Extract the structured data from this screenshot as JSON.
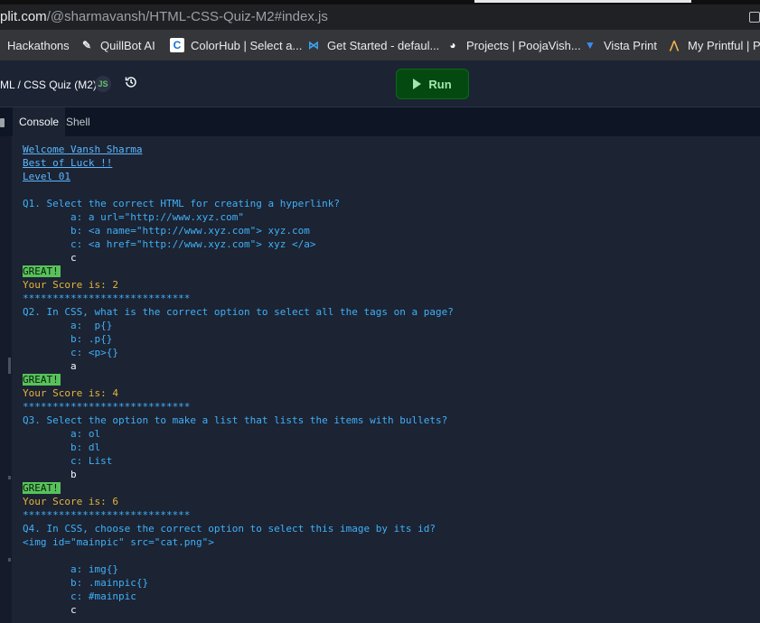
{
  "browser": {
    "url_host": "plit.com",
    "url_path": "/@sharmavansh/HTML-CSS-Quiz-M2#index.js",
    "bookmarks": [
      {
        "label": "Hackathons",
        "icon": "none"
      },
      {
        "label": "QuillBot AI",
        "icon": "quillbot-icon"
      },
      {
        "label": "ColorHub | Select a...",
        "icon": "colorhub-icon"
      },
      {
        "label": "Get Started - defaul...",
        "icon": "vscode-icon"
      },
      {
        "label": "Projects | PoojaVish...",
        "icon": "projects-icon"
      },
      {
        "label": "Vista Print",
        "icon": "vistaprint-icon"
      },
      {
        "label": "My Printful | Pr",
        "icon": "printful-icon"
      }
    ]
  },
  "repl": {
    "title": "ML / CSS Quiz (M2)",
    "run_label": "Run"
  },
  "tabs": [
    {
      "label": "Console",
      "active": true
    },
    {
      "label": "Shell",
      "active": false
    }
  ],
  "console": {
    "lines": [
      {
        "kind": "under",
        "text": "Welcome Vansh Sharma"
      },
      {
        "kind": "under",
        "text": "Best of Luck !!"
      },
      {
        "kind": "under",
        "text": "Level 01"
      },
      {
        "kind": "blank",
        "text": ""
      },
      {
        "kind": "q",
        "text": "Q1. Select the correct HTML for creating a hyperlink?"
      },
      {
        "kind": "q",
        "text": "        a: a url=\"http://www.xyz.com\""
      },
      {
        "kind": "q",
        "text": "        b: <a name=\"http://www.xyz.com\"> xyz.com"
      },
      {
        "kind": "q",
        "text": "        c: <a href=\"http://www.xyz.com\"> xyz </a>"
      },
      {
        "kind": "answer",
        "text": "        c"
      },
      {
        "kind": "great",
        "text": "GREAT!"
      },
      {
        "kind": "score",
        "text": "Your Score is: 2"
      },
      {
        "kind": "q",
        "text": "****************************"
      },
      {
        "kind": "q",
        "text": "Q2. In CSS, what is the correct option to select all the tags on a page?"
      },
      {
        "kind": "q",
        "text": "        a:  p{}"
      },
      {
        "kind": "q",
        "text": "        b: .p{}"
      },
      {
        "kind": "q",
        "text": "        c: <p>{}"
      },
      {
        "kind": "answer",
        "text": "        a"
      },
      {
        "kind": "great",
        "text": "GREAT!"
      },
      {
        "kind": "score",
        "text": "Your Score is: 4"
      },
      {
        "kind": "q",
        "text": "****************************"
      },
      {
        "kind": "q",
        "text": "Q3. Select the option to make a list that lists the items with bullets?"
      },
      {
        "kind": "q",
        "text": "        a: ol"
      },
      {
        "kind": "q",
        "text": "        b: dl"
      },
      {
        "kind": "q",
        "text": "        c: List"
      },
      {
        "kind": "answer",
        "text": "        b"
      },
      {
        "kind": "great",
        "text": "GREAT!"
      },
      {
        "kind": "score",
        "text": "Your Score is: 6"
      },
      {
        "kind": "q",
        "text": "****************************"
      },
      {
        "kind": "q",
        "text": "Q4. In CSS, choose the correct option to select this image by its id?"
      },
      {
        "kind": "q",
        "text": "<img id=\"mainpic\" src=\"cat.png\">"
      },
      {
        "kind": "blank",
        "text": ""
      },
      {
        "kind": "q",
        "text": "        a: img{}"
      },
      {
        "kind": "q",
        "text": "        b: .mainpic{}"
      },
      {
        "kind": "q",
        "text": "        c: #mainpic"
      },
      {
        "kind": "answer",
        "text": "        c"
      }
    ]
  },
  "colors": {
    "console_bg": "#1c2333",
    "run_button_bg": "#044a10",
    "question_text": "#3fb1f8",
    "score_text": "#e6b53a",
    "great_badge": "#57c25a"
  }
}
